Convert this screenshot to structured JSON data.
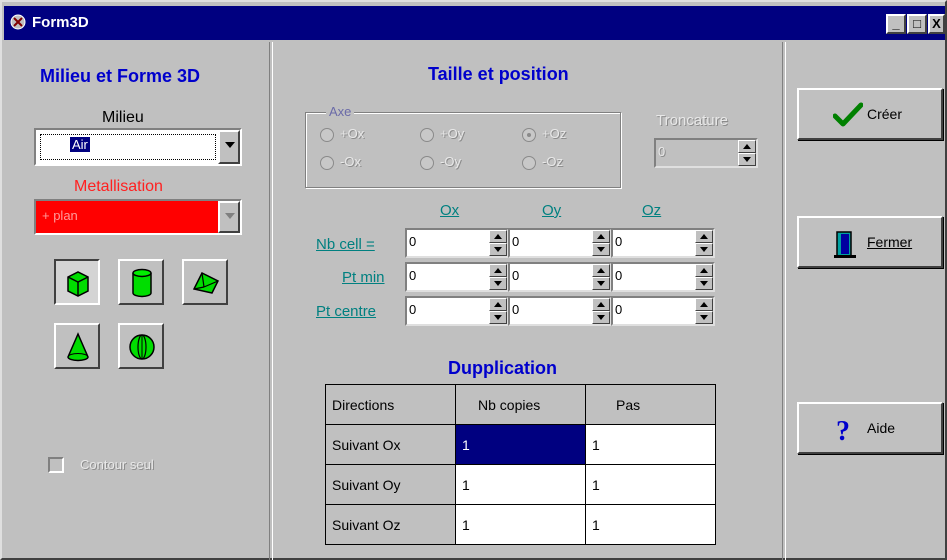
{
  "window": {
    "title": "Form3D",
    "min": "_",
    "max": "□",
    "close": "X"
  },
  "left": {
    "heading": "Milieu et Forme 3D",
    "milieu_label": "Milieu",
    "milieu_value": "Air",
    "metal_label": "Metallisation",
    "metal_value": "+ plan",
    "shapes": [
      "cube-icon",
      "cylinder-icon",
      "prism-icon",
      "cone-icon",
      "sphere-icon"
    ],
    "contour_label": "Contour seul"
  },
  "middle": {
    "heading": "Taille et position",
    "axe": {
      "legend": "Axe",
      "options": [
        "+Ox",
        "+Oy",
        "+Oz",
        "-Ox",
        "-Oy",
        "-Oz"
      ],
      "selected": "+Oz"
    },
    "troncature": {
      "label": "Troncature",
      "value": "0"
    },
    "cols": [
      "Ox",
      "Oy",
      "Oz"
    ],
    "rows": [
      {
        "label": "Nb cell =",
        "values": [
          "0",
          "0",
          "0"
        ]
      },
      {
        "label": "Pt min",
        "values": [
          "0",
          "0",
          "0"
        ]
      },
      {
        "label": "Pt centre",
        "values": [
          "0",
          "0",
          "0"
        ]
      }
    ],
    "dup_heading": "Dupplication",
    "dup_table": {
      "headers": [
        "Directions",
        "Nb copies",
        "Pas"
      ],
      "rows": [
        [
          "Suivant Ox",
          "1",
          "1"
        ],
        [
          "Suivant Oy",
          "1",
          "1"
        ],
        [
          "Suivant Oz",
          "1",
          "1"
        ]
      ]
    }
  },
  "right": {
    "creer": "Créer",
    "fermer": "Fermer",
    "aide": "Aide"
  },
  "colors": {
    "title_bar": "#000080",
    "heading": "#0000cc",
    "metal_red": "#ff0000",
    "link_teal": "#008080",
    "shape_green": "#00cc00"
  }
}
